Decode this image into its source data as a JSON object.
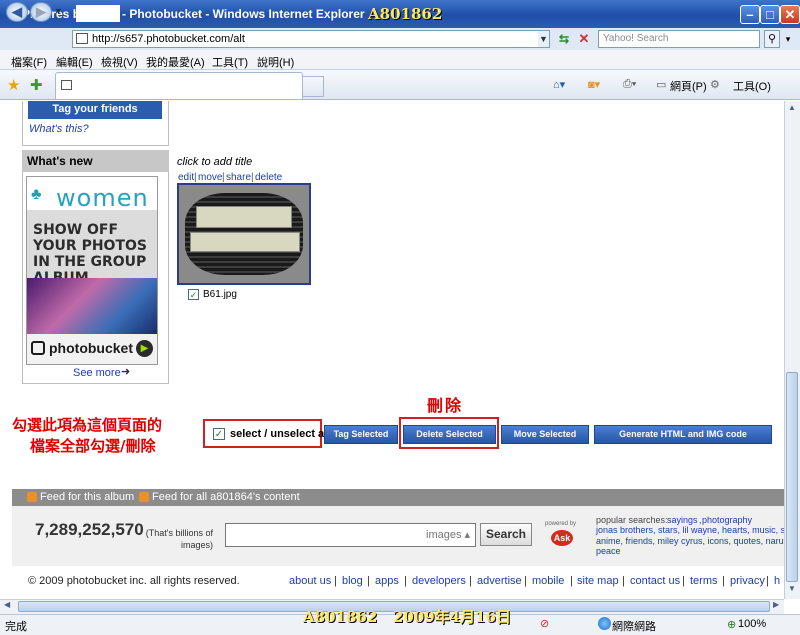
{
  "window": {
    "title_prefix": "Pictures by",
    "title_suffix": "- Photobucket - Windows Internet Explorer",
    "watermark_top": "A801862",
    "minimize": "–",
    "maximize": "□",
    "close": "✕"
  },
  "address": {
    "url": "http://s657.photobucket.com/alt",
    "search_placeholder": "Yahoo! Search"
  },
  "menu": [
    "檔案(F)",
    "編輯(E)",
    "檢視(V)",
    "我的最愛(A)",
    "工具(T)",
    "說明(H)"
  ],
  "toolbar": {
    "page": "網頁(P)",
    "tools": "工具(O)"
  },
  "sidebar": {
    "tag_friends": "Tag your friends",
    "whats_this": "What's this?",
    "whats_new": "What's new",
    "ad_women": "women",
    "ad_text": "SHOW OFF YOUR PHOTOS IN THE GROUP ALBUM",
    "ad_brand": "photobucket",
    "see_more": "See more"
  },
  "photo": {
    "click_title": "click to add title",
    "actions": [
      "edit",
      "move",
      "share",
      "delete"
    ],
    "filename": "B61.jpg",
    "checked": true
  },
  "annotations": {
    "line1": "勾選此項為這個頁面的",
    "line2": "檔案全部勾選/刪除",
    "delete": "刪除"
  },
  "bulk": {
    "select_label": "select / unselect all",
    "buttons": [
      "Tag Selected",
      "Delete Selected",
      "Move Selected",
      "Generate HTML and IMG code"
    ]
  },
  "feeds": {
    "album": "Feed for this album",
    "all": "Feed for all a801864's content"
  },
  "stats": {
    "count": "7,289,252,570",
    "note": "(That's billions of images)"
  },
  "search": {
    "scope": "images",
    "button": "Search",
    "powered": "powered by",
    "ask": "Ask"
  },
  "popular": {
    "title": "popular searches:",
    "line1": [
      "sayings",
      "photography"
    ],
    "line2": "jonas brothers, stars, lil wayne, hearts, music, sex",
    "line3": "anime, friends, miley cyrus, icons, quotes, naruto",
    "line4": "peace"
  },
  "footer": {
    "copyright": "© 2009 photobucket inc. all rights reserved.",
    "links": [
      "about us",
      "blog",
      "apps",
      "developers",
      "advertise",
      "mobile",
      "site map",
      "contact us",
      "terms",
      "privacy",
      "h"
    ]
  },
  "status": {
    "text": "完成",
    "watermark_bottom": "A801862   2009年4月16日",
    "zone": "網際網路",
    "zoom": "100%"
  },
  "colors": {
    "accent": "#2656a8",
    "annotation_red": "#e00000",
    "watermark": "#ffe860"
  }
}
